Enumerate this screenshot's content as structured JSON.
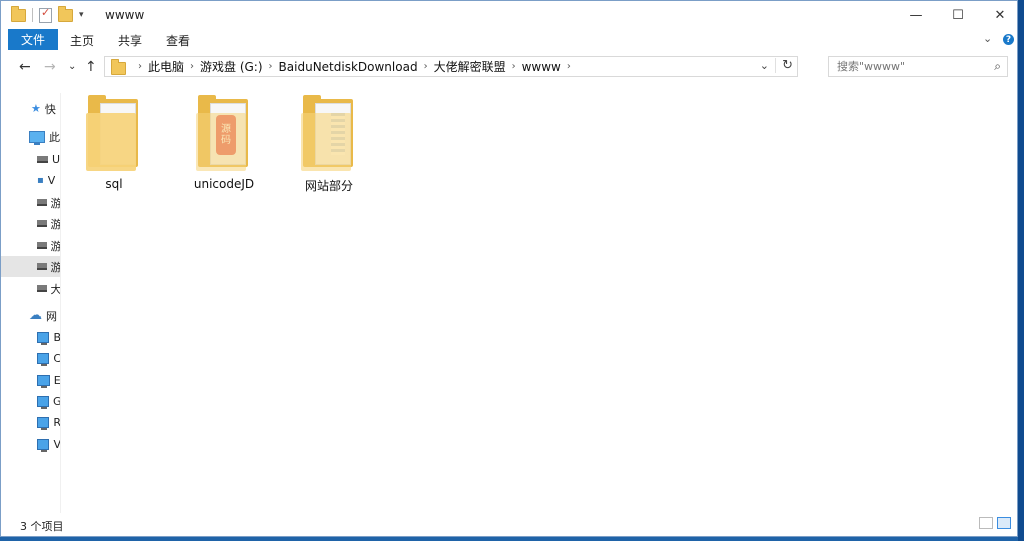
{
  "window": {
    "title": "wwww"
  },
  "controls": {
    "minimize": "—",
    "maximize": "☐",
    "close": "✕"
  },
  "ribbon": {
    "file_tab": "文件",
    "tabs": [
      "主页",
      "共享",
      "查看"
    ],
    "expand": "⌄",
    "help": "?"
  },
  "nav": {
    "back": "←",
    "forward": "→",
    "recent": "⌄",
    "up": "↑",
    "breadcrumbs": [
      "此电脑",
      "游戏盘 (G:)",
      "BaiduNetdiskDownload",
      "大佬解密联盟",
      "wwww"
    ],
    "search_placeholder": "搜索\"wwww\""
  },
  "sidebar": {
    "items": [
      {
        "label": "快",
        "icon": "star-icon"
      },
      {
        "label": "此",
        "icon": "pc-icon"
      },
      {
        "label": "U",
        "icon": "drive-icon"
      },
      {
        "label": "V",
        "icon": "network-drive-icon"
      },
      {
        "label": "游",
        "icon": "drive-icon"
      },
      {
        "label": "游",
        "icon": "drive-icon"
      },
      {
        "label": "游",
        "icon": "drive-icon"
      },
      {
        "label": "游",
        "icon": "drive-icon",
        "selected": true
      },
      {
        "label": "大",
        "icon": "drive-icon"
      },
      {
        "label": "网",
        "icon": "network-icon"
      },
      {
        "label": "B",
        "icon": "monitor-icon"
      },
      {
        "label": "C",
        "icon": "monitor-icon"
      },
      {
        "label": "E",
        "icon": "monitor-icon"
      },
      {
        "label": "G",
        "icon": "monitor-icon"
      },
      {
        "label": "R",
        "icon": "monitor-icon"
      },
      {
        "label": "V",
        "icon": "monitor-icon"
      }
    ]
  },
  "files": [
    {
      "name": "sql",
      "icon": "folder-icon"
    },
    {
      "name": "unicodeJD",
      "icon": "folder-icon",
      "stamp": [
        "源",
        "码"
      ]
    },
    {
      "name": "网站部分",
      "icon": "folder-icon"
    }
  ],
  "status": {
    "count_text": "3 个项目"
  }
}
